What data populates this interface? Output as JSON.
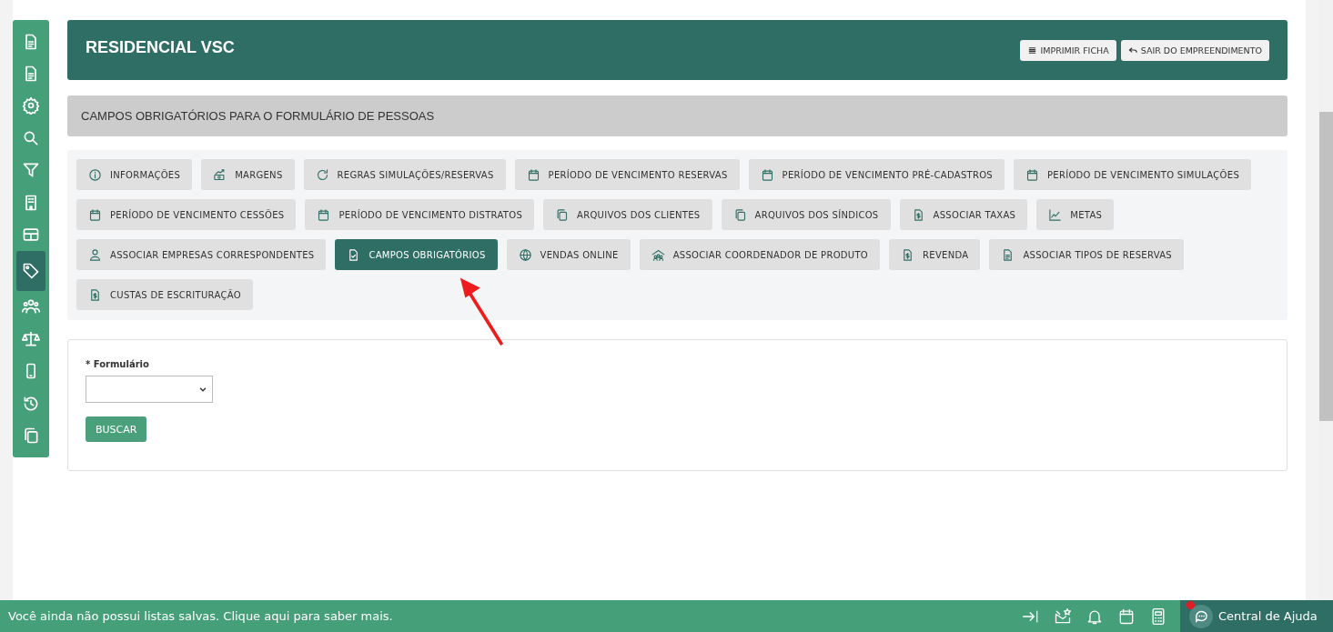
{
  "sidebar": {
    "items": [
      {
        "kind": "document",
        "selected": false
      },
      {
        "kind": "document",
        "selected": false
      },
      {
        "kind": "gear",
        "selected": false
      },
      {
        "kind": "search",
        "selected": false
      },
      {
        "kind": "filter",
        "selected": false
      },
      {
        "kind": "building",
        "selected": false
      },
      {
        "kind": "table",
        "selected": false
      },
      {
        "kind": "tag",
        "selected": true
      },
      {
        "kind": "users",
        "selected": false
      },
      {
        "kind": "scale",
        "selected": false
      },
      {
        "kind": "phone",
        "selected": false
      },
      {
        "kind": "history",
        "selected": false
      },
      {
        "kind": "copy",
        "selected": false
      }
    ]
  },
  "header": {
    "title": "RESIDENCIAL VSC",
    "buttons": [
      {
        "kind": "list",
        "label": "IMPRIMIR FICHA"
      },
      {
        "kind": "reply",
        "label": "SAIR DO EMPREENDIMENTO"
      }
    ]
  },
  "section_title": "CAMPOS OBRIGATÓRIOS PARA O FORMULÁRIO DE PESSOAS",
  "tabs": [
    {
      "kind": "info",
      "label": "INFORMAÇÕES",
      "selected": false
    },
    {
      "kind": "money",
      "label": "MARGENS",
      "selected": false
    },
    {
      "kind": "refresh",
      "label": "REGRAS SIMULAÇÕES/RESERVAS",
      "selected": false
    },
    {
      "kind": "calendar",
      "label": "PERÍODO DE VENCIMENTO RESERVAS",
      "selected": false
    },
    {
      "kind": "calendar",
      "label": "PERÍODO DE VENCIMENTO PRÉ-CADASTROS",
      "selected": false
    },
    {
      "kind": "calendar",
      "label": "PERÍODO DE VENCIMENTO SIMULAÇÕES",
      "selected": false
    },
    {
      "kind": "calendar",
      "label": "PERÍODO DE VENCIMENTO CESSÕES",
      "selected": false
    },
    {
      "kind": "calendar",
      "label": "PERÍODO DE VENCIMENTO DISTRATOS",
      "selected": false
    },
    {
      "kind": "copy",
      "label": "ARQUIVOS DOS CLIENTES",
      "selected": false
    },
    {
      "kind": "copy",
      "label": "ARQUIVOS DOS SÍNDICOS",
      "selected": false
    },
    {
      "kind": "invoice",
      "label": "ASSOCIAR TAXAS",
      "selected": false
    },
    {
      "kind": "chart",
      "label": "METAS",
      "selected": false
    },
    {
      "kind": "user",
      "label": "ASSOCIAR EMPRESAS CORRESPONDENTES",
      "selected": false
    },
    {
      "kind": "filecheck",
      "label": "CAMPOS OBRIGATÓRIOS",
      "selected": true
    },
    {
      "kind": "globe",
      "label": "VENDAS ONLINE",
      "selected": false
    },
    {
      "kind": "group",
      "label": "ASSOCIAR COORDENADOR DE PRODUTO",
      "selected": false
    },
    {
      "kind": "invoice",
      "label": "REVENDA",
      "selected": false
    },
    {
      "kind": "document",
      "label": "ASSOCIAR TIPOS DE RESERVAS",
      "selected": false
    },
    {
      "kind": "invoice",
      "label": "CUSTAS DE ESCRITURAÇÃO",
      "selected": false
    }
  ],
  "form": {
    "field_label": "* Formulário",
    "button": "BUSCAR"
  },
  "footer": {
    "message": "Você ainda não possui listas salvas. Clique aqui para saber mais.",
    "icons": [
      {
        "kind": "collapse"
      },
      {
        "kind": "mailstar"
      },
      {
        "kind": "bell"
      },
      {
        "kind": "calendar"
      },
      {
        "kind": "calculator"
      }
    ],
    "help": {
      "label": "Central de Ajuda",
      "notification": true
    }
  }
}
